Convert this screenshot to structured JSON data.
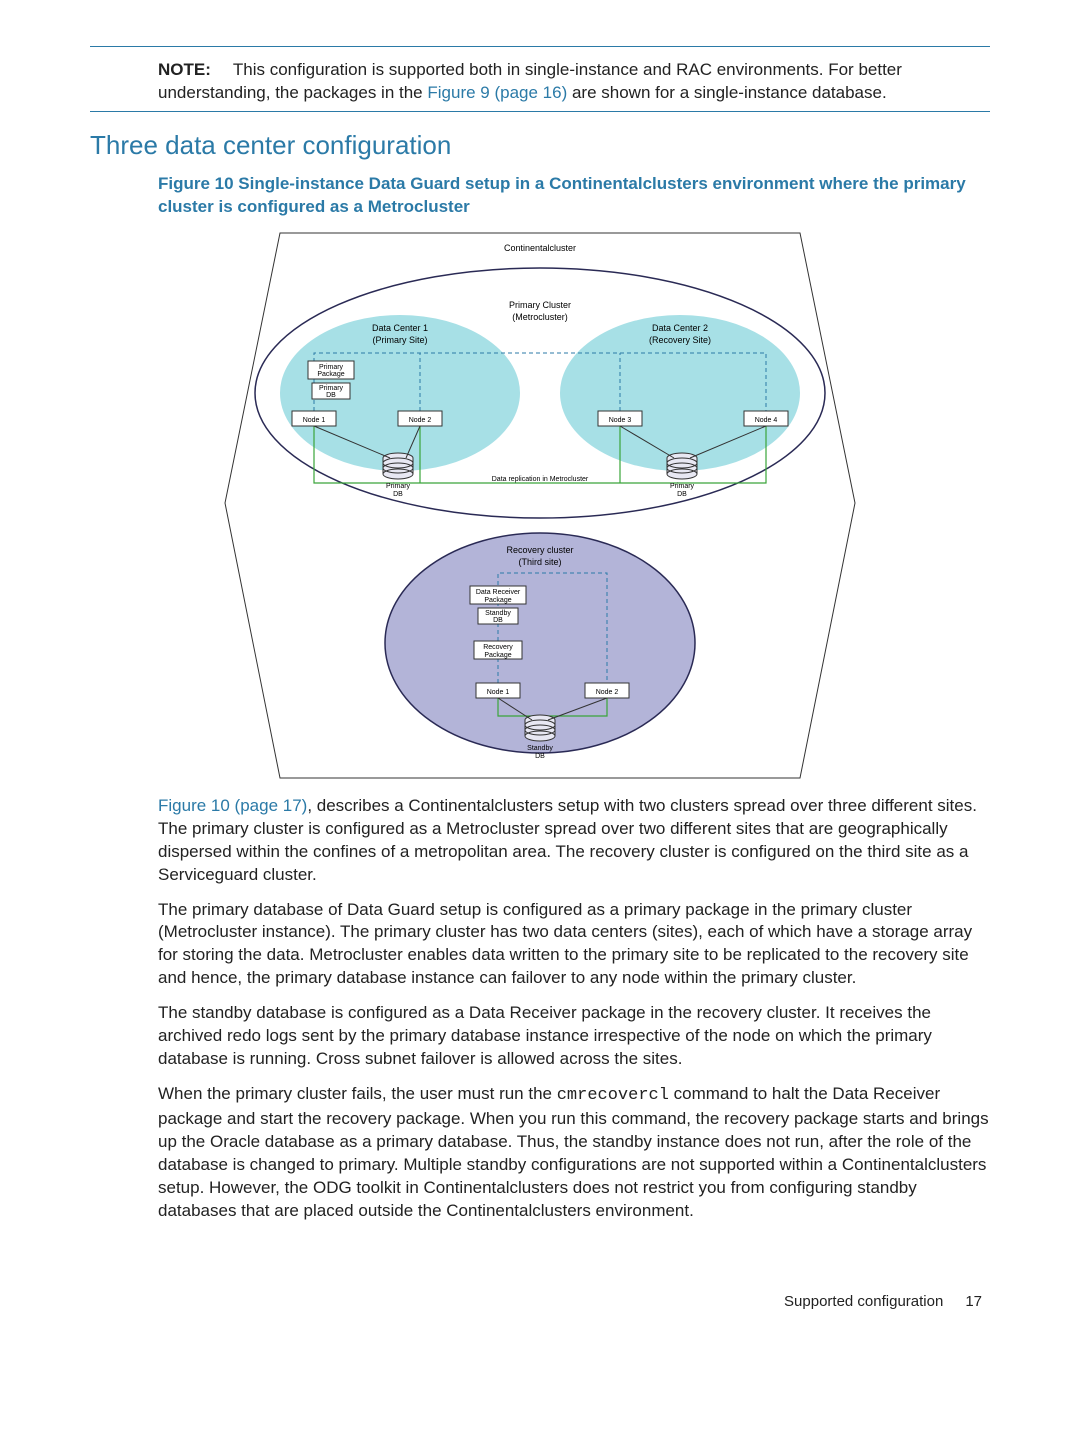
{
  "note": {
    "label": "NOTE:",
    "text_before_link": "This configuration is supported both in single-instance and RAC environments. For better understanding, the packages in the ",
    "link": "Figure 9 (page 16)",
    "text_after_link": " are shown for a single-instance database."
  },
  "section_heading": "Three data center configuration",
  "figure": {
    "caption": "Figure 10  Single-instance Data Guard setup in a Continentalclusters environment where the primary cluster is configured as a Metrocluster",
    "labels": {
      "continentalcluster": "Continentalcluster",
      "primary_cluster_l1": "Primary Cluster",
      "primary_cluster_l2": "(Metrocluster)",
      "dc1_l1": "Data Center 1",
      "dc1_l2": "(Primary Site)",
      "dc2_l1": "Data Center 2",
      "dc2_l2": "(Recovery Site)",
      "primary_pkg_l1": "Primary",
      "primary_pkg_l2": "Package",
      "primary_db_l1": "Primary",
      "primary_db_l2": "DB",
      "node1": "Node 1",
      "node2": "Node 2",
      "node3": "Node 3",
      "node4": "Node 4",
      "repl": "Data replication in Metrocluster",
      "primary_db_left_l1": "Primary",
      "primary_db_left_l2": "DB",
      "primary_db_right_l1": "Primary",
      "primary_db_right_l2": "DB",
      "recovery_l1": "Recovery cluster",
      "recovery_l2": "(Third site)",
      "dr_pkg_l1": "Data Receiver",
      "dr_pkg_l2": "Package",
      "standby_db_l1": "Standby",
      "standby_db_l2": "DB",
      "rec_pkg_l1": "Recovery",
      "rec_pkg_l2": "Package",
      "r_node1": "Node 1",
      "r_node2": "Node 2",
      "standby_cyl_l1": "Standby",
      "standby_cyl_l2": "DB"
    }
  },
  "paragraphs": {
    "p1_link": "Figure 10 (page 17)",
    "p1_rest": ", describes a Continentalclusters setup with two clusters spread over three different sites. The primary cluster is configured as a Metrocluster spread over two different sites that are geographically dispersed within the confines of a metropolitan area. The recovery cluster is configured on the third site as a Serviceguard cluster.",
    "p2": "The primary database of Data Guard setup is configured as a primary package in the primary cluster (Metrocluster instance). The primary cluster has two data centers (sites), each of which have a storage array for storing the data. Metrocluster enables data written to the primary site to be replicated to the recovery site and hence, the primary database instance can failover to any node within the primary cluster.",
    "p3": "The standby database is configured as a Data Receiver package in the recovery cluster. It receives the archived redo logs sent by the primary database instance irrespective of the node on which the primary database is running. Cross subnet failover is allowed across the sites.",
    "p4_before": "When the primary cluster fails, the user must run the ",
    "p4_code": "cmrecovercl",
    "p4_after": " command to halt the Data Receiver package and start the recovery package. When you run this command, the recovery package starts and brings up the Oracle database as a primary database. Thus, the standby instance does not run, after the role of the database is changed to primary. Multiple standby configurations are not supported within a Continentalclusters setup. However, the ODG toolkit in Continentalclusters does not restrict you from configuring standby databases that are placed outside the Continentalclusters environment."
  },
  "footer": {
    "title": "Supported configuration",
    "page": "17"
  }
}
